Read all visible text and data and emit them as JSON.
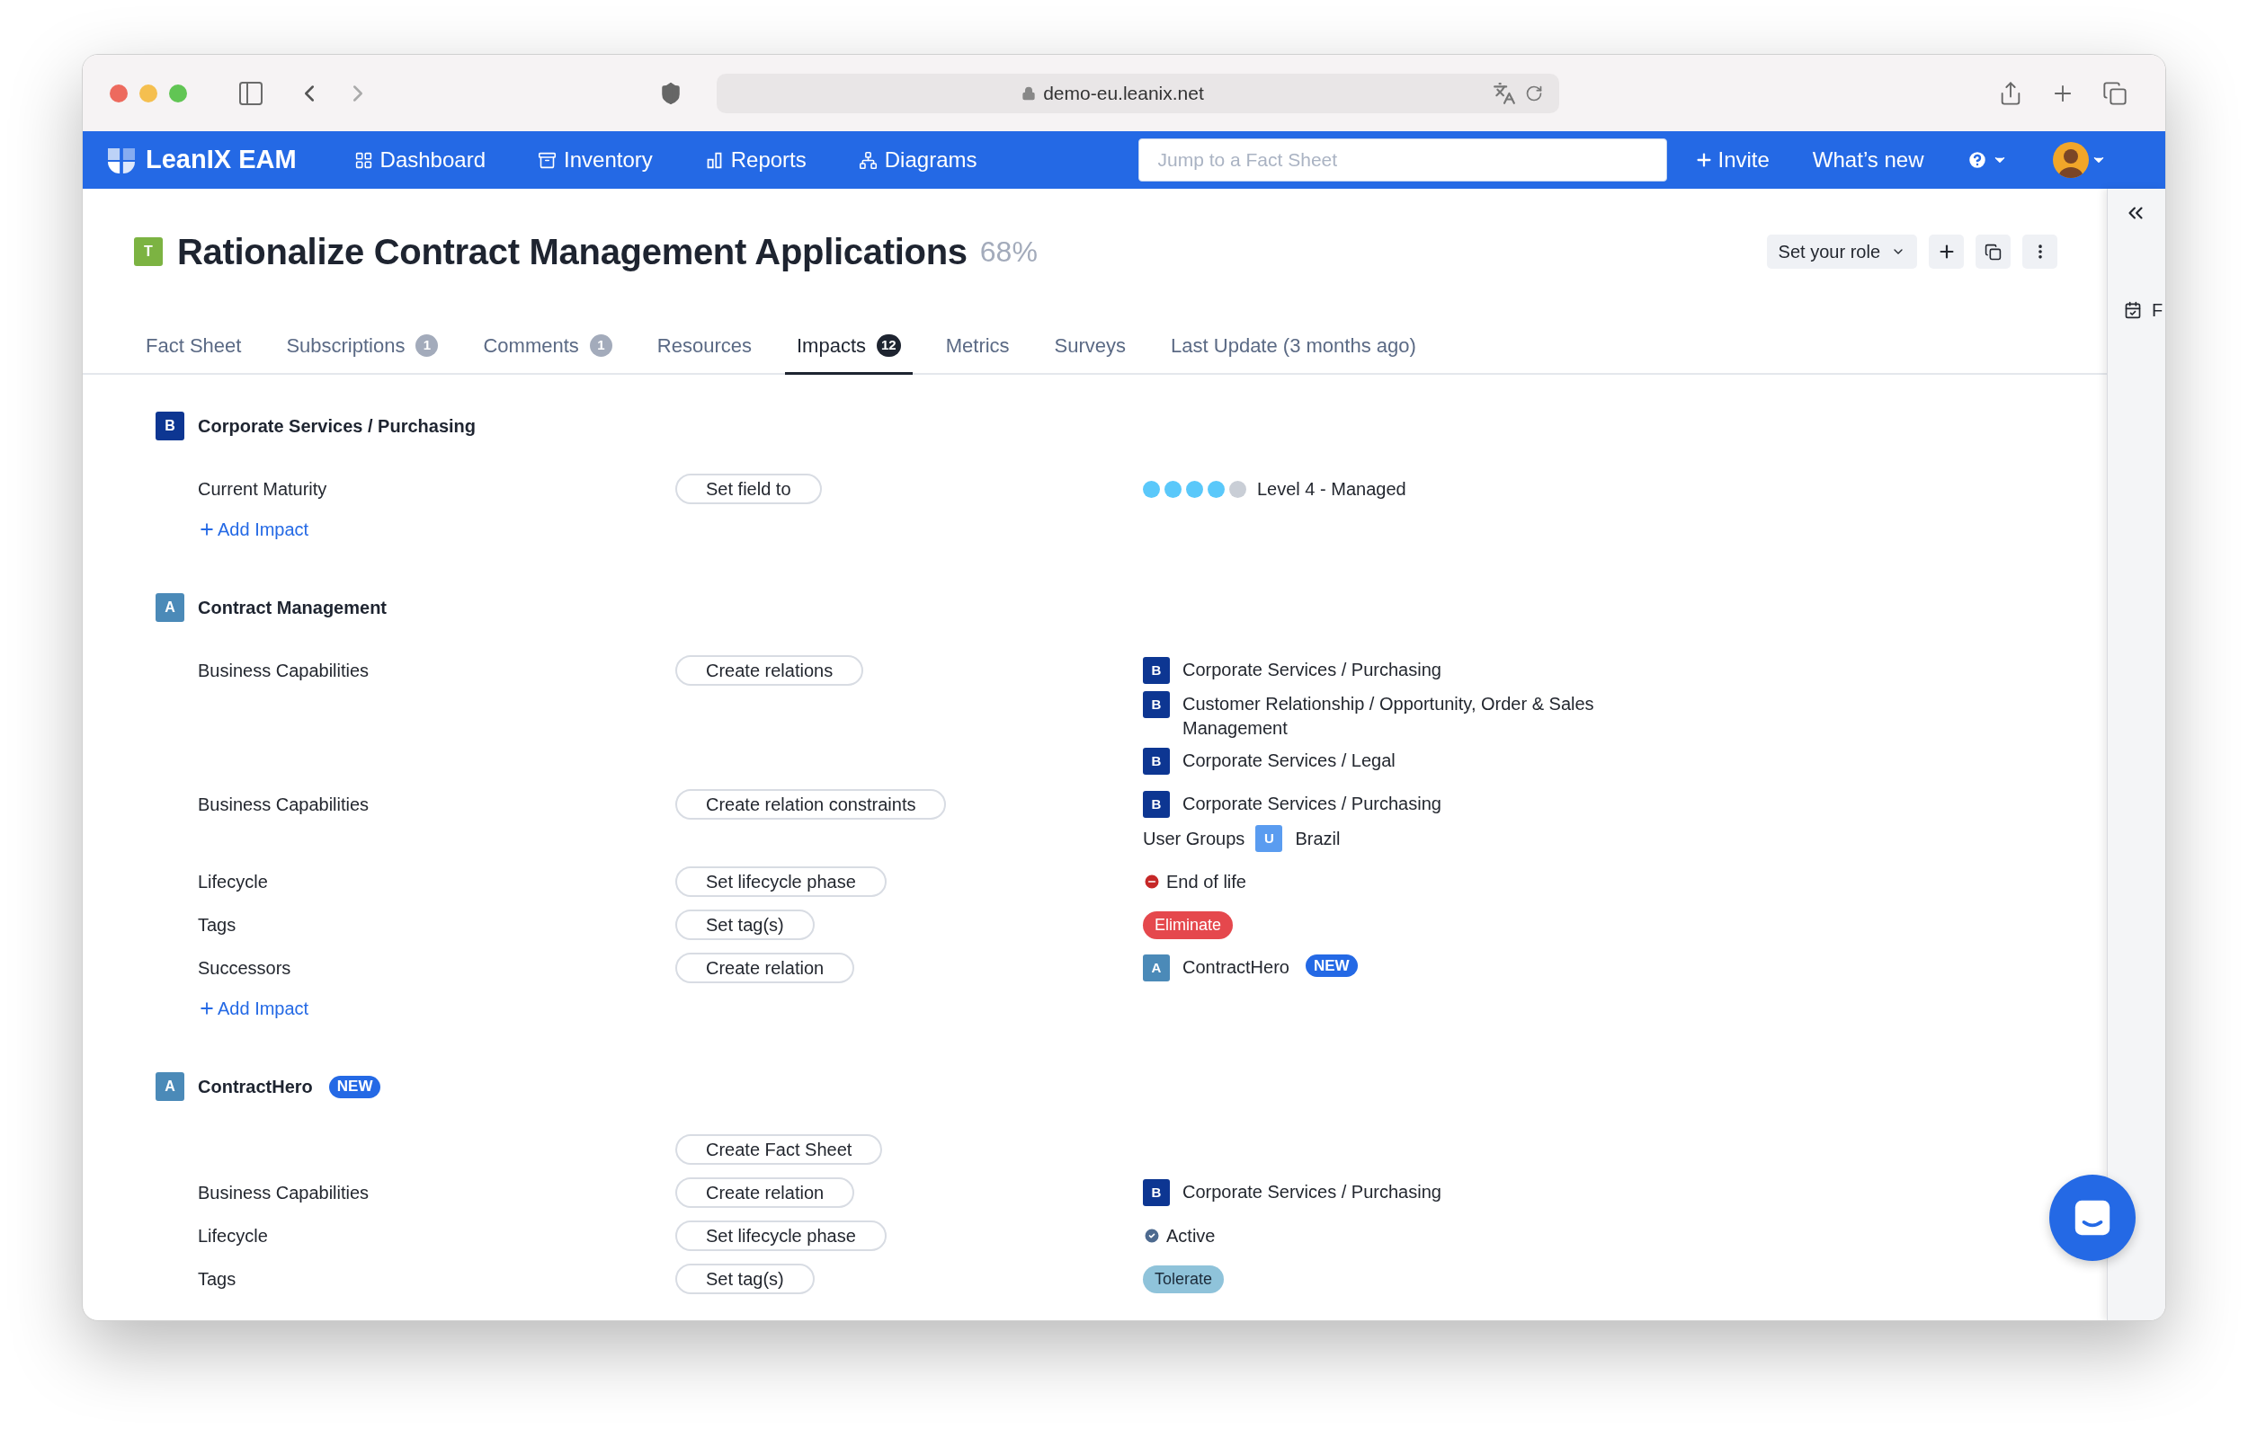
{
  "browser": {
    "url": "demo-eu.leanix.net"
  },
  "nav": {
    "brand": "LeanIX EAM",
    "items": [
      "Dashboard",
      "Inventory",
      "Reports",
      "Diagrams"
    ],
    "search": {
      "placeholder": "Jump to a Fact Sheet"
    },
    "invite": "Invite",
    "whats_new": "What’s new"
  },
  "header": {
    "letter": "T",
    "color": "#7cb342",
    "title": "Rationalize Contract Management Applications",
    "completion": "68%",
    "role_button": "Set your role"
  },
  "tabs": [
    {
      "label": "Fact Sheet",
      "selected": false
    },
    {
      "label": "Subscriptions",
      "badge": "1",
      "selected": false
    },
    {
      "label": "Comments",
      "badge": "1",
      "selected": false
    },
    {
      "label": "Resources",
      "selected": false
    },
    {
      "label": "Impacts",
      "badge": "12",
      "selected": true
    },
    {
      "label": "Metrics",
      "selected": false
    },
    {
      "label": "Surveys",
      "selected": false
    },
    {
      "label": "Last Update (3 months ago)",
      "selected": false
    }
  ],
  "sections": [
    {
      "letter": "B",
      "color": "#0d3692",
      "name": "Corporate Services / Purchasing",
      "impacts": [
        {
          "label": "Current Maturity",
          "action": "Set field to",
          "values": [
            {
              "kind": "maturity",
              "stars": 4,
              "text": "Level 4 - Managed"
            }
          ]
        }
      ],
      "add_impact": "Add Impact"
    },
    {
      "letter": "A",
      "color": "#4b8ab8",
      "name": "Contract Management",
      "impacts": [
        {
          "label": "Business Capabilities",
          "action": "Create relations",
          "values": [
            {
              "kind": "factsheet",
              "letter": "B",
              "color": "#0d3692",
              "text": "Corporate Services / Purchasing"
            },
            {
              "kind": "factsheet",
              "letter": "B",
              "color": "#0d3692",
              "text": "Customer Relationship / Opportunity, Order & Sales Management"
            },
            {
              "kind": "factsheet",
              "letter": "B",
              "color": "#0d3692",
              "text": "Corporate Services / Legal"
            }
          ]
        },
        {
          "label": "Business Capabilities",
          "action": "Create relation constraints",
          "values": [
            {
              "kind": "factsheet",
              "letter": "B",
              "color": "#0d3692",
              "text": "Corporate Services / Purchasing"
            },
            {
              "kind": "group",
              "prefix": "User Groups",
              "letter": "U",
              "color": "#5a9cf0",
              "text": "Brazil"
            }
          ]
        },
        {
          "label": "Lifecycle",
          "action": "Set lifecycle phase",
          "values": [
            {
              "kind": "lifecycle_end",
              "text": "End of life"
            }
          ]
        },
        {
          "label": "Tags",
          "action": "Set tag(s)",
          "values": [
            {
              "kind": "tag",
              "color": "#e5484d",
              "text": "Eliminate"
            }
          ]
        },
        {
          "label": "Successors",
          "action": "Create relation",
          "values": [
            {
              "kind": "factsheet",
              "letter": "A",
              "color": "#4b8ab8",
              "text": "ContractHero",
              "badge": "NEW"
            }
          ]
        }
      ],
      "add_impact": "Add Impact"
    },
    {
      "letter": "A",
      "color": "#4b8ab8",
      "name": "ContractHero",
      "badge": "NEW",
      "impacts": [
        {
          "action": "Create Fact Sheet"
        },
        {
          "label": "Business Capabilities",
          "action": "Create relation",
          "values": [
            {
              "kind": "factsheet",
              "letter": "B",
              "color": "#0d3692",
              "text": "Corporate Services / Purchasing"
            }
          ]
        },
        {
          "label": "Lifecycle",
          "action": "Set lifecycle phase",
          "values": [
            {
              "kind": "lifecycle_active",
              "text": "Active"
            }
          ]
        },
        {
          "label": "Tags",
          "action": "Set tag(s)",
          "values": [
            {
              "kind": "tag",
              "color": "#8fc3da",
              "text": "Tolerate"
            }
          ]
        }
      ]
    }
  ],
  "side_panel": {
    "item": "F"
  }
}
